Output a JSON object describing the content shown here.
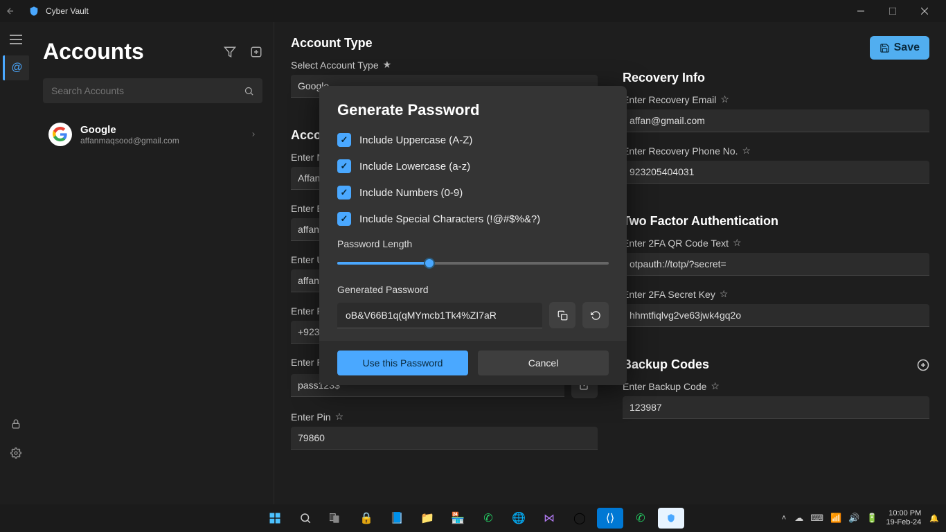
{
  "titlebar": {
    "app_name": "Cyber Vault"
  },
  "sidebar": {
    "heading": "Accounts",
    "search_placeholder": "Search Accounts",
    "account": {
      "name": "Google",
      "email": "affanmaqsood@gmail.com"
    }
  },
  "form": {
    "account_type": {
      "title": "Account Type",
      "select_label": "Select Account Type",
      "value": "Google"
    },
    "account_info": {
      "title": "Account Info",
      "name_label": "Enter Name",
      "name_value": "Affan",
      "email_label": "Enter Email",
      "email_value": "affan",
      "url_label": "Enter URL",
      "url_value": "affan",
      "phone_label": "Enter Phone",
      "phone_value": "+923",
      "password_label": "Enter Password",
      "password_value": "pass123$",
      "pin_label": "Enter Pin",
      "pin_value": "79860"
    },
    "recovery": {
      "title": "Recovery Info",
      "email_label": "Enter Recovery Email",
      "email_value": "affan@gmail.com",
      "phone_label": "Enter Recovery Phone No.",
      "phone_value": "923205404031"
    },
    "twofa": {
      "title": "Two Factor Authentication",
      "qr_label": "Enter 2FA QR Code Text",
      "qr_value": "otpauth://totp/?secret=",
      "secret_label": "Enter 2FA Secret Key",
      "secret_value": "hhmtfiqlvg2ve63jwk4gq2o"
    },
    "backup": {
      "title": "Backup Codes",
      "code_label": "Enter Backup Code",
      "code_value": "123987"
    },
    "save": "Save"
  },
  "modal": {
    "title": "Generate Password",
    "opt_upper": "Include Uppercase (A-Z)",
    "opt_lower": "Include Lowercase (a-z)",
    "opt_num": "Include Numbers (0-9)",
    "opt_special": "Include Special Characters (!@#$%&?)",
    "length_label": "Password Length",
    "generated_label": "Generated Password",
    "generated_value": "oB&V66B1q(qMYmcb1Tk4%ZI7aR",
    "use_btn": "Use this Password",
    "cancel_btn": "Cancel"
  },
  "taskbar": {
    "time": "10:00 PM",
    "date": "19-Feb-24"
  }
}
